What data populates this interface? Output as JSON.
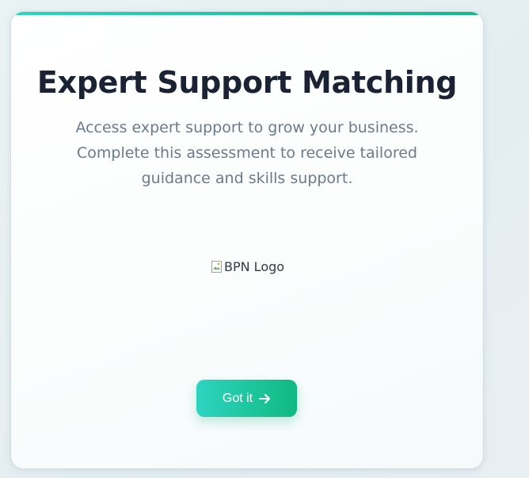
{
  "card": {
    "title": "Expert Support Matching",
    "description": "Access expert support to grow your business. Complete this assessment to receive tailored guidance and skills support.",
    "logo_alt": "BPN Logo",
    "button_label": "Got it",
    "button_icon": "arrow-right-icon"
  },
  "colors": {
    "accent_start": "#2dd4bf",
    "accent_end": "#10b981",
    "title": "#1a2233",
    "body_text": "#6b7a8c"
  }
}
